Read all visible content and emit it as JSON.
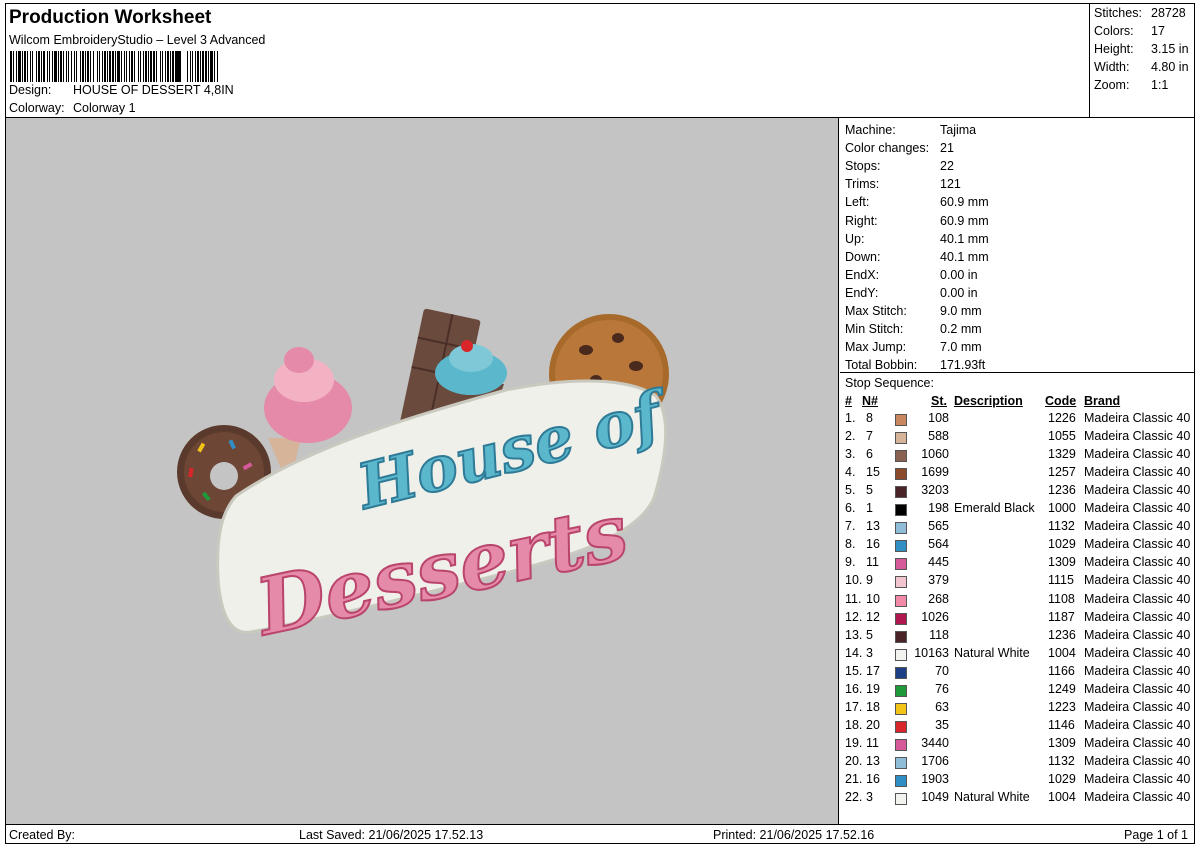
{
  "header": {
    "title": "Production Worksheet",
    "software": "Wilcom EmbroideryStudio – Level 3 Advanced",
    "design_label": "Design:",
    "design_value": "HOUSE OF DESSERT 4,8IN",
    "colorway_label": "Colorway:",
    "colorway_value": "Colorway 1"
  },
  "summary": {
    "stitches_label": "Stitches:",
    "stitches": "28728",
    "colors_label": "Colors:",
    "colors": "17",
    "height_label": "Height:",
    "height": "3.15 in",
    "width_label": "Width:",
    "width": "4.80 in",
    "zoom_label": "Zoom:",
    "zoom": "1:1"
  },
  "preview": {
    "design_text_line1": "House of",
    "design_text_line2": "Desserts"
  },
  "machine": [
    {
      "label": "Machine:",
      "value": "Tajima"
    },
    {
      "label": "Color changes:",
      "value": "21"
    },
    {
      "label": "Stops:",
      "value": "22"
    },
    {
      "label": "Trims:",
      "value": "121"
    },
    {
      "label": "Left:",
      "value": "60.9 mm"
    },
    {
      "label": "Right:",
      "value": "60.9 mm"
    },
    {
      "label": "Up:",
      "value": "40.1 mm"
    },
    {
      "label": "Down:",
      "value": "40.1 mm"
    },
    {
      "label": "EndX:",
      "value": "0.00 in"
    },
    {
      "label": "EndY:",
      "value": "0.00 in"
    },
    {
      "label": "Max Stitch:",
      "value": "9.0 mm"
    },
    {
      "label": "Min Stitch:",
      "value": "0.2 mm"
    },
    {
      "label": "Max Jump:",
      "value": "7.0 mm"
    },
    {
      "label": "Total Bobbin:",
      "value": "171.93ft"
    }
  ],
  "stop_sequence": {
    "title": "Stop Sequence:",
    "headers": {
      "num": "#",
      "n": "N#",
      "st": "St.",
      "desc": "Description",
      "code": "Code",
      "brand": "Brand"
    },
    "rows": [
      {
        "idx": "1.",
        "n": "8",
        "color": "#c8875e",
        "st": "108",
        "desc": "",
        "code": "1226",
        "brand": "Madeira Classic 40"
      },
      {
        "idx": "2.",
        "n": "7",
        "color": "#d6b49a",
        "st": "588",
        "desc": "",
        "code": "1055",
        "brand": "Madeira Classic 40"
      },
      {
        "idx": "3.",
        "n": "6",
        "color": "#8a6150",
        "st": "1060",
        "desc": "",
        "code": "1329",
        "brand": "Madeira Classic 40"
      },
      {
        "idx": "4.",
        "n": "15",
        "color": "#8c4a2c",
        "st": "1699",
        "desc": "",
        "code": "1257",
        "brand": "Madeira Classic 40"
      },
      {
        "idx": "5.",
        "n": "5",
        "color": "#4a2328",
        "st": "3203",
        "desc": "",
        "code": "1236",
        "brand": "Madeira Classic 40"
      },
      {
        "idx": "6.",
        "n": "1",
        "color": "#000000",
        "st": "198",
        "desc": "Emerald Black",
        "code": "1000",
        "brand": "Madeira Classic 40"
      },
      {
        "idx": "7.",
        "n": "13",
        "color": "#8fbcd6",
        "st": "565",
        "desc": "",
        "code": "1132",
        "brand": "Madeira Classic 40"
      },
      {
        "idx": "8.",
        "n": "16",
        "color": "#2f8fc4",
        "st": "564",
        "desc": "",
        "code": "1029",
        "brand": "Madeira Classic 40"
      },
      {
        "idx": "9.",
        "n": "11",
        "color": "#d65a9a",
        "st": "445",
        "desc": "",
        "code": "1309",
        "brand": "Madeira Classic 40"
      },
      {
        "idx": "10.",
        "n": "9",
        "color": "#f2c4cf",
        "st": "379",
        "desc": "",
        "code": "1115",
        "brand": "Madeira Classic 40"
      },
      {
        "idx": "11.",
        "n": "10",
        "color": "#f08aa6",
        "st": "268",
        "desc": "",
        "code": "1108",
        "brand": "Madeira Classic 40"
      },
      {
        "idx": "12.",
        "n": "12",
        "color": "#b0174e",
        "st": "1026",
        "desc": "",
        "code": "1187",
        "brand": "Madeira Classic 40"
      },
      {
        "idx": "13.",
        "n": "5",
        "color": "#4a2328",
        "st": "118",
        "desc": "",
        "code": "1236",
        "brand": "Madeira Classic 40"
      },
      {
        "idx": "14.",
        "n": "3",
        "color": "#f2f2ee",
        "st": "10163",
        "desc": "Natural White",
        "code": "1004",
        "brand": "Madeira Classic 40"
      },
      {
        "idx": "15.",
        "n": "17",
        "color": "#1d3f86",
        "st": "70",
        "desc": "",
        "code": "1166",
        "brand": "Madeira Classic 40"
      },
      {
        "idx": "16.",
        "n": "19",
        "color": "#1f9a3a",
        "st": "76",
        "desc": "",
        "code": "1249",
        "brand": "Madeira Classic 40"
      },
      {
        "idx": "17.",
        "n": "18",
        "color": "#f2c418",
        "st": "63",
        "desc": "",
        "code": "1223",
        "brand": "Madeira Classic 40"
      },
      {
        "idx": "18.",
        "n": "20",
        "color": "#d8262a",
        "st": "35",
        "desc": "",
        "code": "1146",
        "brand": "Madeira Classic 40"
      },
      {
        "idx": "19.",
        "n": "11",
        "color": "#d65a9a",
        "st": "3440",
        "desc": "",
        "code": "1309",
        "brand": "Madeira Classic 40"
      },
      {
        "idx": "20.",
        "n": "13",
        "color": "#8fbcd6",
        "st": "1706",
        "desc": "",
        "code": "1132",
        "brand": "Madeira Classic 40"
      },
      {
        "idx": "21.",
        "n": "16",
        "color": "#2f8fc4",
        "st": "1903",
        "desc": "",
        "code": "1029",
        "brand": "Madeira Classic 40"
      },
      {
        "idx": "22.",
        "n": "3",
        "color": "#f2f2ee",
        "st": "1049",
        "desc": "Natural White",
        "code": "1004",
        "brand": "Madeira Classic 40"
      }
    ]
  },
  "footer": {
    "created_by": "Created By:",
    "last_saved": "Last Saved: 21/06/2025 17.52.13",
    "printed": "Printed: 21/06/2025 17.52.16",
    "page": "Page 1 of 1"
  }
}
